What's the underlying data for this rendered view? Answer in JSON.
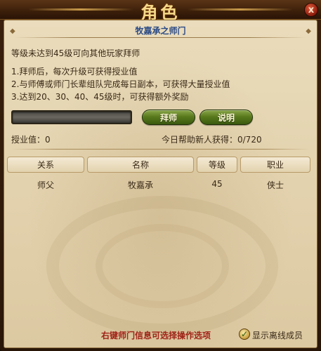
{
  "window": {
    "title": "角色",
    "close_symbol": "x"
  },
  "panel": {
    "title": "牧嘉承之师门",
    "requirement": "等级未达到45级可向其他玩家拜师",
    "rules": [
      "1.拜师后，每次升级可获得授业值",
      "2.与师傅或师门长辈组队完成每日副本，可获得大量授业值",
      "3.达到20、30、40、45级时，可获得额外奖励"
    ]
  },
  "actions": {
    "apprentice_label": "拜师",
    "explain_label": "说明"
  },
  "stats": {
    "teaching_points": "授业值：0",
    "daily_help": "今日帮助新人获得：0/720",
    "progress_value": 0
  },
  "table": {
    "columns": [
      "关系",
      "名称",
      "等级",
      "职业"
    ],
    "rows": [
      [
        "师父",
        "牧嘉承",
        "45",
        "侠士"
      ]
    ]
  },
  "footer": {
    "tip": "右键师门信息可选择操作选项",
    "show_offline_label": "显示离线成员",
    "show_offline_checked": true,
    "check_symbol": "✓"
  },
  "colors": {
    "title_blue": "#2a4a86",
    "tip_red": "#a02418",
    "button_green": "#5a7a1e"
  }
}
